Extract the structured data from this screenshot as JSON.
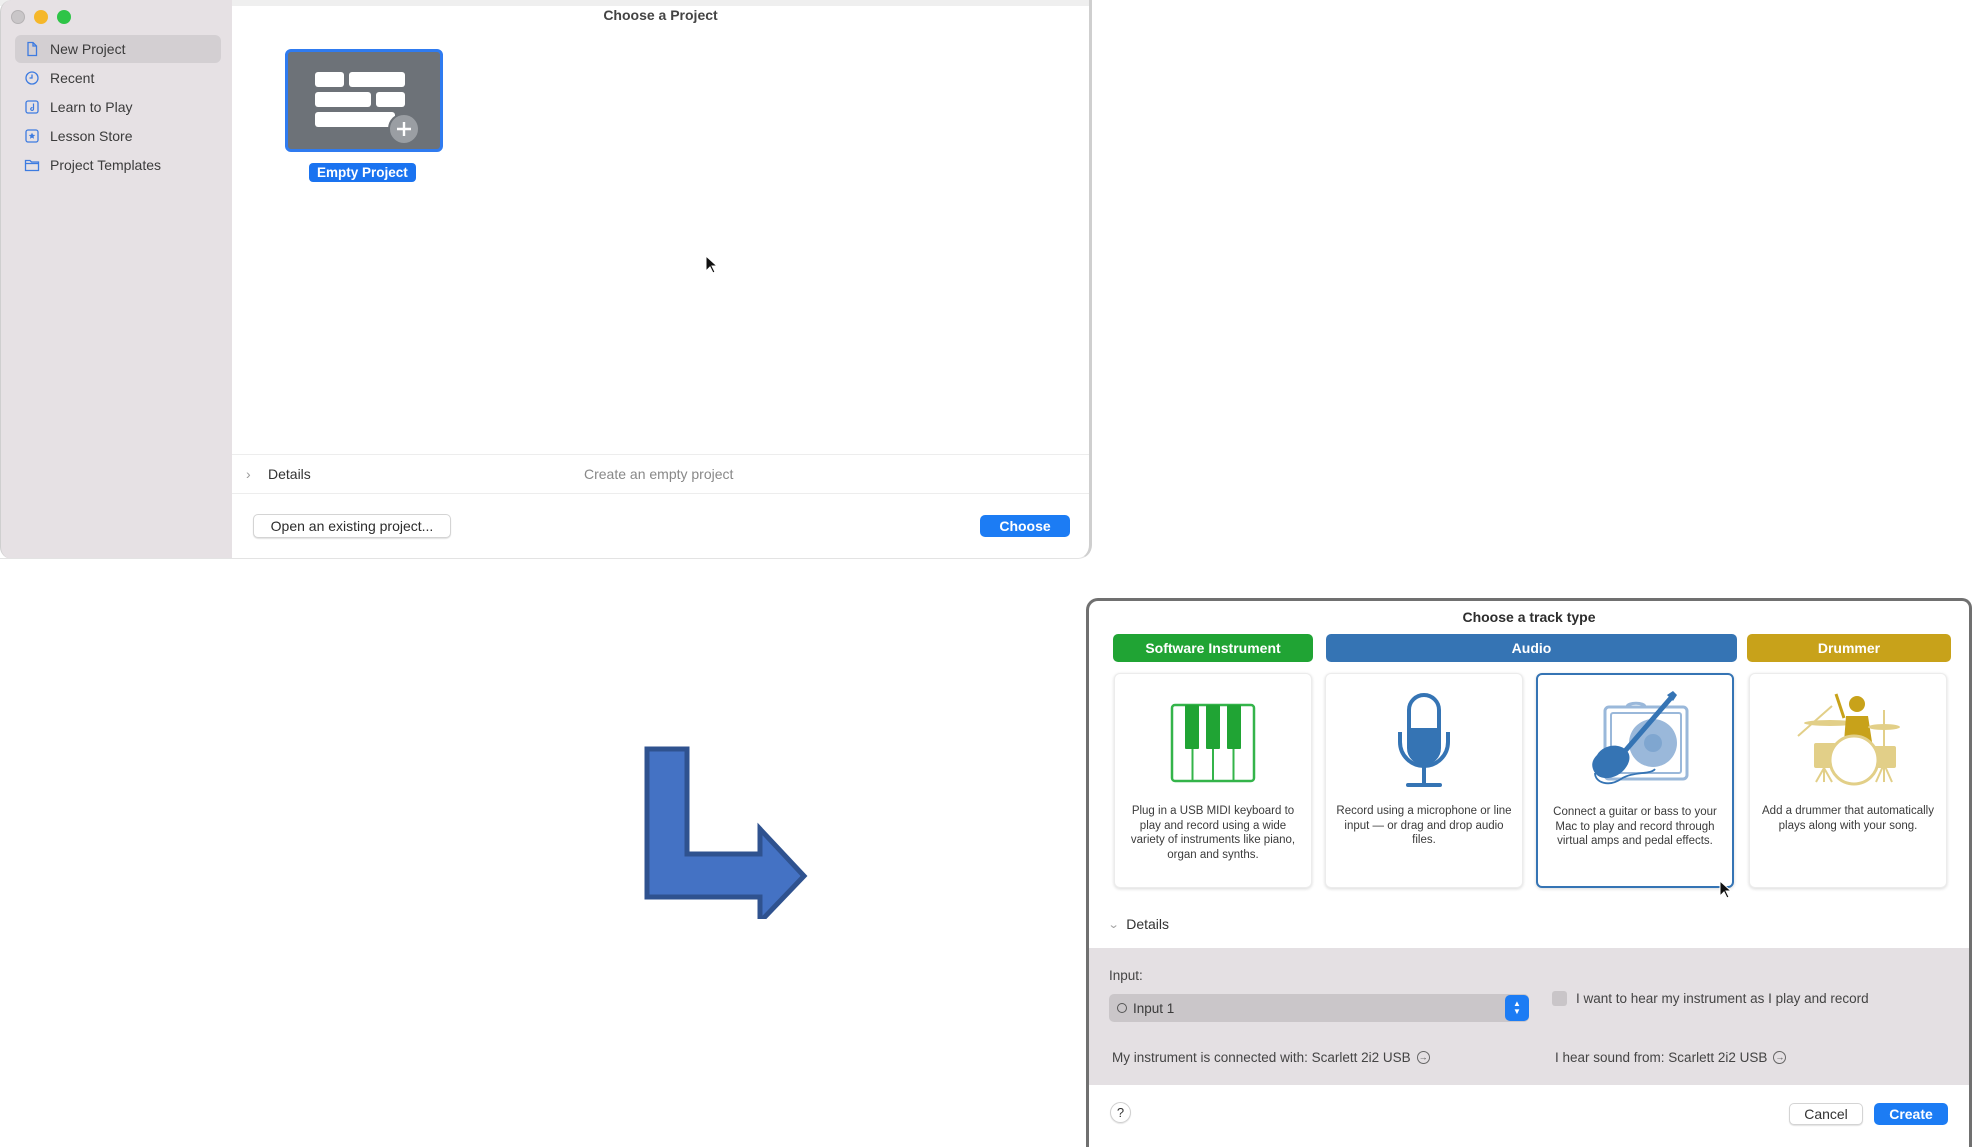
{
  "window1": {
    "title": "Choose a Project",
    "sidebar": {
      "items": [
        {
          "label": "New Project",
          "icon": "document-icon",
          "active": true
        },
        {
          "label": "Recent",
          "icon": "clock-icon",
          "active": false
        },
        {
          "label": "Learn to Play",
          "icon": "music-note-icon",
          "active": false
        },
        {
          "label": "Lesson Store",
          "icon": "star-box-icon",
          "active": false
        },
        {
          "label": "Project Templates",
          "icon": "folder-icon",
          "active": false
        }
      ]
    },
    "project_tile": {
      "label": "Empty Project",
      "icon": "empty-project-icon"
    },
    "details": {
      "label": "Details",
      "description": "Create an empty project"
    },
    "buttons": {
      "open_existing": "Open an existing project...",
      "choose": "Choose"
    }
  },
  "window2": {
    "title": "Choose a track type",
    "categories": [
      {
        "label": "Software Instrument",
        "color": "#20a434"
      },
      {
        "label": "Audio",
        "color": "#3574b4"
      },
      {
        "label": "Drummer",
        "color": "#c8a21a"
      }
    ],
    "cards": [
      {
        "icon": "piano-keyboard-icon",
        "description": "Plug in a USB MIDI keyboard to play and record using a wide variety of instruments like piano, organ and synths.",
        "selected": false
      },
      {
        "icon": "microphone-icon",
        "description": "Record using a microphone or line input — or drag and drop audio files.",
        "selected": false
      },
      {
        "icon": "guitar-amp-icon",
        "description": "Connect a guitar or bass to your Mac to play and record through virtual amps and pedal effects.",
        "selected": true
      },
      {
        "icon": "drummer-icon",
        "description": "Add a drummer that automatically plays along with your song.",
        "selected": false
      }
    ],
    "details": {
      "label": "Details",
      "input_label": "Input:",
      "input_value": "Input 1",
      "monitor_checkbox": {
        "label": "I want to hear my instrument as I play and record",
        "checked": false
      },
      "connected_with": "My instrument is connected with: Scarlett 2i2 USB",
      "hear_sound_from": "I hear sound from: Scarlett 2i2 USB"
    },
    "buttons": {
      "help": "?",
      "cancel": "Cancel",
      "create": "Create"
    }
  },
  "colors": {
    "accent_blue": "#1c7cf4",
    "arrow_fill": "#4472c4",
    "arrow_stroke": "#2f528f"
  }
}
